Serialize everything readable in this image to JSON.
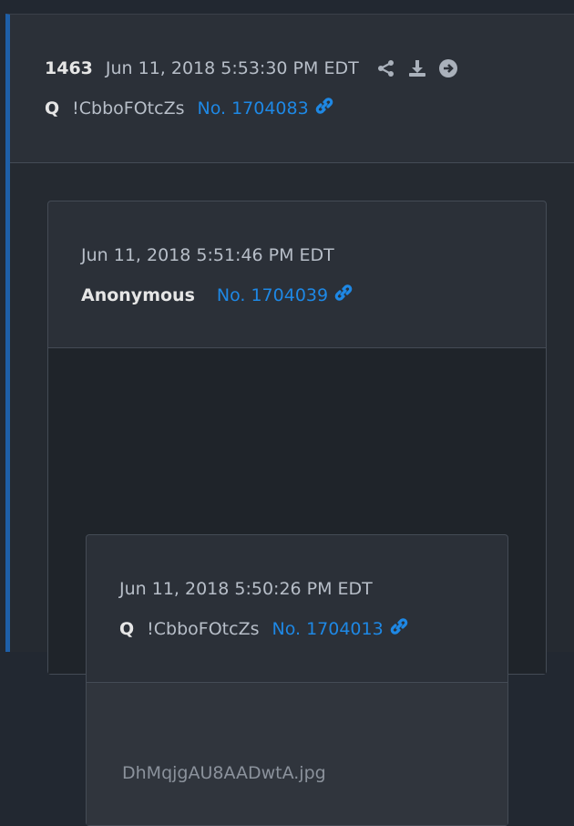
{
  "post": {
    "number": "1463",
    "timestamp": "Jun 11, 2018 5:53:30 PM EDT",
    "author": "Q",
    "tripcode": "!CbboFOtcZs",
    "post_no": "No. 1704083",
    "icons": [
      "share-icon",
      "download-icon",
      "arrow-right-circle-icon",
      "link-icon"
    ]
  },
  "quote1": {
    "timestamp": "Jun 11, 2018 5:51:46 PM EDT",
    "author": "Anonymous",
    "post_no": "No. 1704039"
  },
  "quote2": {
    "timestamp": "Jun 11, 2018 5:50:26 PM EDT",
    "author": "Q",
    "tripcode": "!CbboFOtcZs",
    "post_no": "No. 1704013",
    "filename": "DhMqjgAU8AADwtA.jpg"
  },
  "colors": {
    "accent": "#1e88e5",
    "left_border": "#1e5fa8",
    "background": "#222831"
  }
}
